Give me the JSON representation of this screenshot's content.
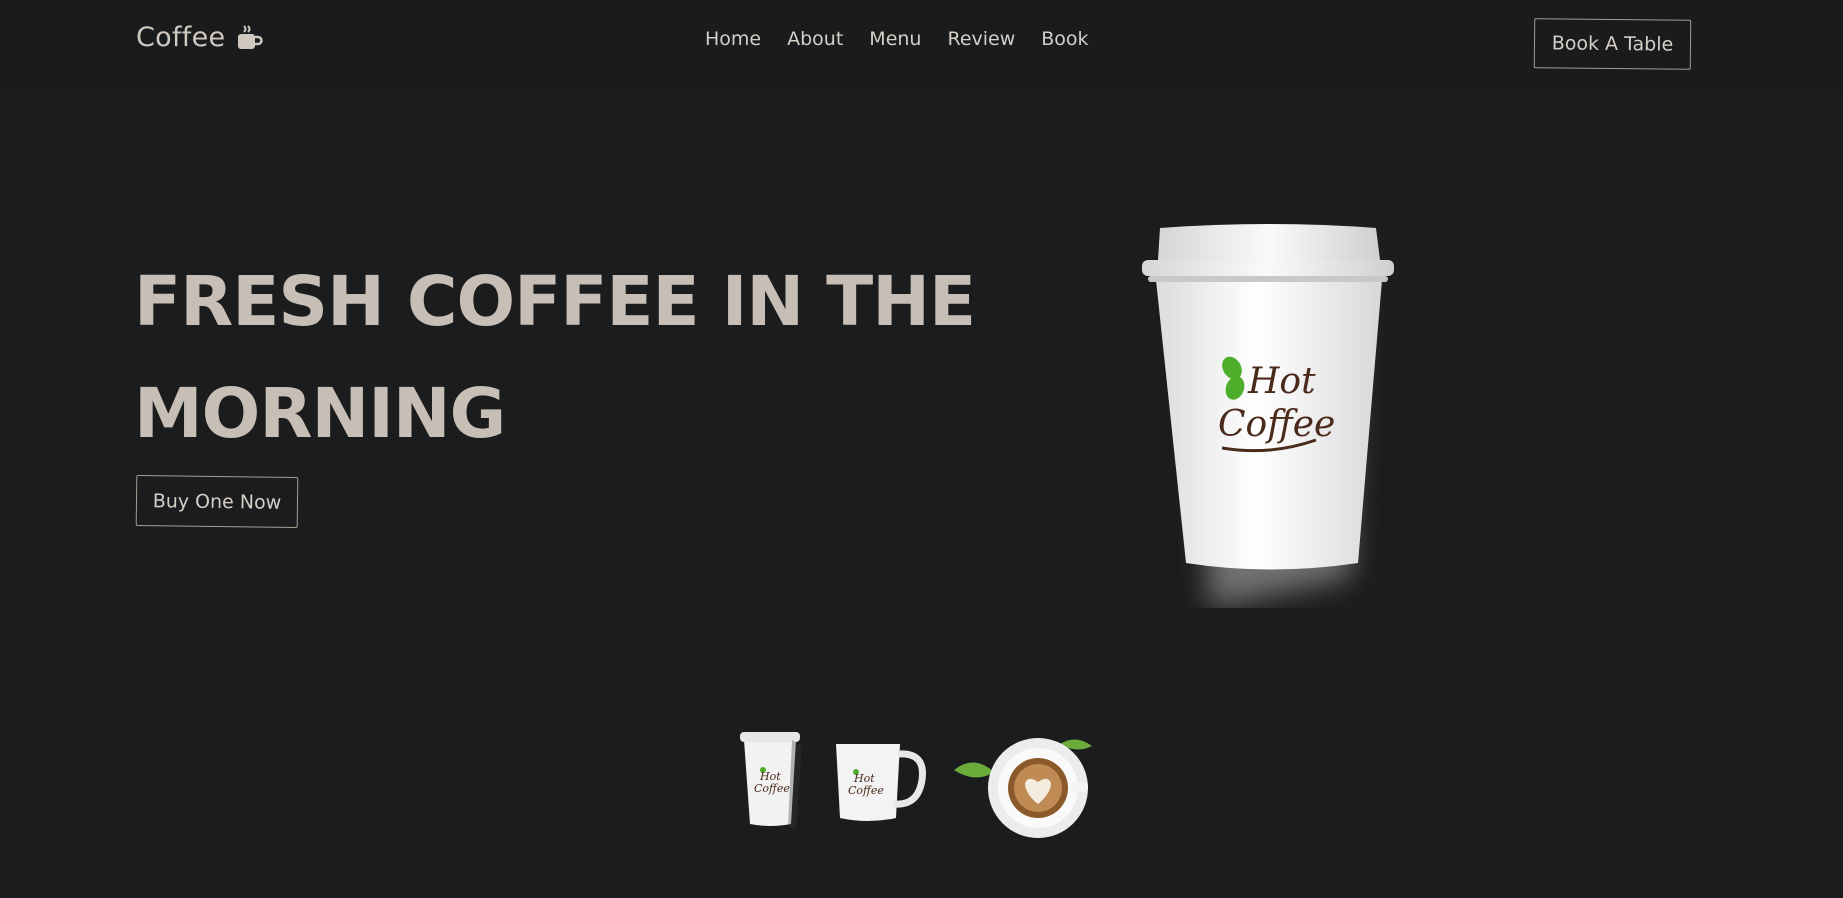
{
  "header": {
    "logo_text": "Coffee",
    "logo_icon": "coffee-cup-icon",
    "nav": [
      "Home",
      "About",
      "Menu",
      "Review",
      "Book"
    ],
    "cta_label": "Book A Table"
  },
  "hero": {
    "title_line1": "FRESH COFFEE IN THE",
    "title_line2": "MORNING",
    "button_label": "Buy One Now",
    "cup_brand_line1": "Hot",
    "cup_brand_line2": "Coffee"
  },
  "colors": {
    "background": "#1b1c1e",
    "text": "#c7bfb5",
    "accent_border": "#a49d92",
    "brand_brown": "#4a2a1a",
    "brand_green": "#4cae2a"
  },
  "thumbnails": [
    "paper-cup",
    "mug",
    "latte-cup"
  ]
}
